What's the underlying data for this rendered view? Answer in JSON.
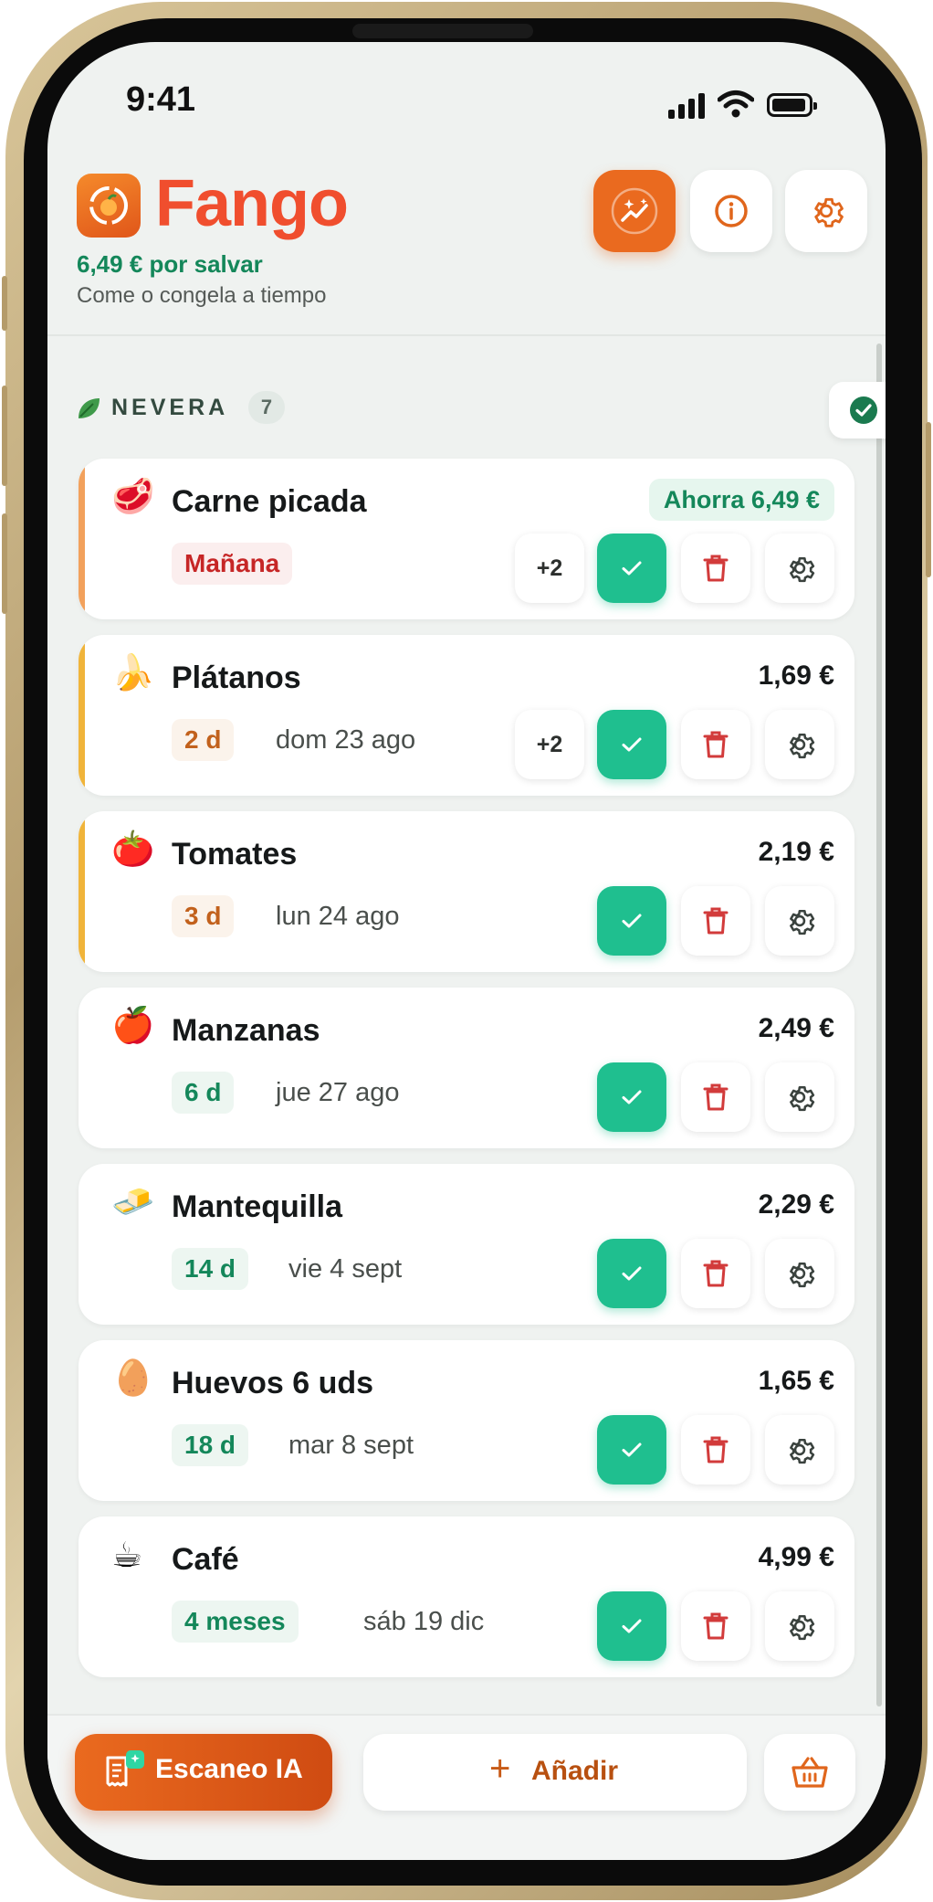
{
  "status_bar": {
    "time": "9:41"
  },
  "header": {
    "brand": "Fango",
    "savings": "6,49 € por salvar",
    "hint": "Come o congela a tiempo"
  },
  "section": {
    "title": "NEVERA",
    "count": "7"
  },
  "items": [
    {
      "emoji": "🥩",
      "name": "Carne picada",
      "price": "",
      "save_label": "Ahorra 6,49 €",
      "badge": "Mañana",
      "date": "",
      "extra": "+2",
      "accent": "#f2a15c"
    },
    {
      "emoji": "🍌",
      "name": "Plátanos",
      "price": "1,69 €",
      "badge": "2 d",
      "date": "dom 23 ago",
      "extra": "+2",
      "accent": "#f0b43a"
    },
    {
      "emoji": "🍅",
      "name": "Tomates",
      "price": "2,19 €",
      "badge": "3 d",
      "date": "lun 24 ago",
      "extra": "",
      "accent": "#f0b43a"
    },
    {
      "emoji": "🍎",
      "name": "Manzanas",
      "price": "2,49 €",
      "badge": "6 d",
      "date": "jue 27 ago",
      "extra": "",
      "accent": ""
    },
    {
      "emoji": "🧈",
      "name": "Mantequilla",
      "price": "2,29 €",
      "badge": "14 d",
      "date": "vie 4 sept",
      "extra": "",
      "accent": ""
    },
    {
      "emoji": "🥚",
      "name": "Huevos 6 uds",
      "price": "1,65 €",
      "badge": "18 d",
      "date": "mar 8 sept",
      "extra": "",
      "accent": ""
    },
    {
      "emoji": "☕",
      "name": "Café",
      "price": "4,99 €",
      "badge": "4 meses",
      "date": "sáb 19 dic",
      "extra": "",
      "accent": ""
    }
  ],
  "bottom_bar": {
    "scan_label": "Escaneo IA",
    "add_plus": "+",
    "add_label": "Añadir"
  },
  "colors": {
    "brand": "#f04e2e",
    "accent_green": "#1fbf8f",
    "savings_green": "#14875a",
    "scan_orange": "#ea6a1f"
  }
}
